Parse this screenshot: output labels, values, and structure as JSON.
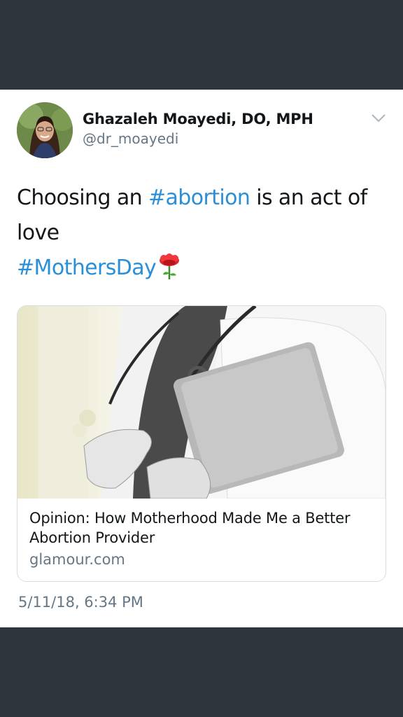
{
  "author": {
    "display_name": "Ghazaleh Moayedi, DO, MPH",
    "handle": "@dr_moayedi"
  },
  "tweet": {
    "segments": [
      {
        "text": "Choosing an ",
        "type": "text"
      },
      {
        "text": "#abortion",
        "type": "hashtag"
      },
      {
        "text": " is an act of love",
        "type": "text"
      }
    ],
    "hashtag_line": "#MothersDay",
    "emoji": "rose-icon"
  },
  "card": {
    "title": "Opinion: How Motherhood Made Me a Better Abortion Provider",
    "domain": "glamour.com"
  },
  "timestamp": "5/11/18, 6:34 PM",
  "colors": {
    "hashtag": "#2b8fd8",
    "secondary_text": "#657786",
    "frame": "#2f353d"
  }
}
